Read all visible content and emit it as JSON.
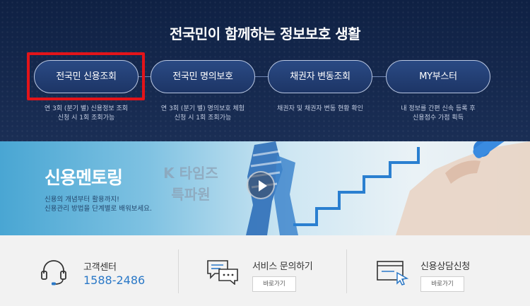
{
  "header": {
    "title": "전국민이 함께하는 정보보호 생활"
  },
  "services": [
    {
      "label": "전국민 신용조회",
      "desc": [
        "연 3회 (분기 별) 신용정보 조회",
        "신청 시 1회 조회가능"
      ]
    },
    {
      "label": "전국민 명의보호",
      "desc": [
        "연 3회 (분기 별) 명의보호 체험",
        "신청 시 1회 조회가능"
      ]
    },
    {
      "label": "채권자 변동조회",
      "desc": [
        "채권자 및 채권자 변동 현황 확인"
      ]
    },
    {
      "label": "MY부스터",
      "desc": [
        "내 정보를 간편 신속 등록 후",
        "신용점수 가점 획득"
      ]
    }
  ],
  "banner": {
    "title": "신용멘토링",
    "desc": [
      "신용의 개념부터 활용까지!",
      "신용관리 방법을 단계별로 배워보세요."
    ],
    "watermark": [
      "K 타임즈",
      "특파원"
    ]
  },
  "support": {
    "customer_center": {
      "label": "고객센터",
      "phone": "1588-2486"
    },
    "inquiry": {
      "label": "서비스 문의하기",
      "button": "바로가기"
    },
    "counsel": {
      "label": "신용상담신청",
      "button": "바로가기"
    }
  },
  "colors": {
    "navy_bg": "#14264a",
    "highlight": "#e3141a",
    "phone_blue": "#2a78c7"
  },
  "icons": {
    "customer_center": "headset-icon",
    "inquiry": "chat-bubbles-icon",
    "counsel": "cursor-window-icon",
    "play": "play-icon"
  }
}
